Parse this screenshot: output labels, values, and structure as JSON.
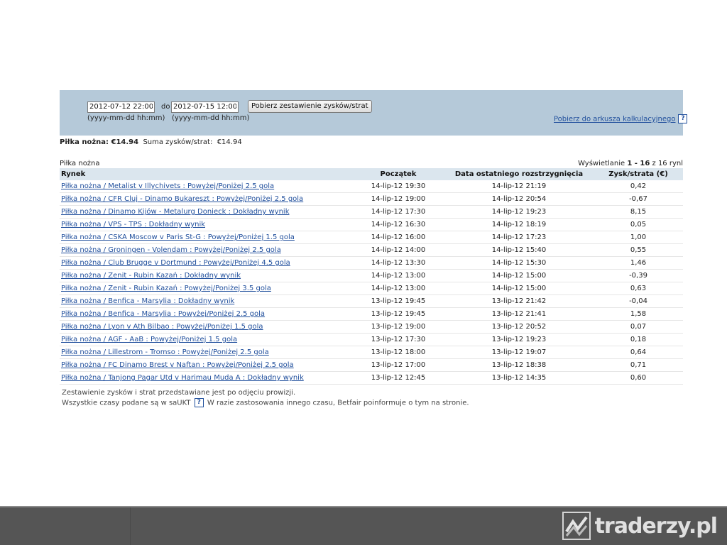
{
  "filter": {
    "date_from": "2012-07-12 22:00",
    "separator": "do",
    "date_to": "2012-07-15 12:00",
    "format_hint_from": "(yyyy-mm-dd hh:mm)",
    "format_hint_to": "(yyyy-mm-dd hh:mm)",
    "fetch_button": "Pobierz zestawienie zysków/strat",
    "download_link": "Pobierz do arkusza kalkulacyjnego",
    "help_glyph": "?"
  },
  "summary": {
    "sport_label": "Piłka nożna: €14.94",
    "total_label": "Suma zysków/strat:",
    "total_value": "€14.94"
  },
  "table": {
    "caption": "Piłka nożna",
    "showing_prefix": "Wyświetlanie",
    "showing_range": "1 - 16",
    "showing_suffix": "z 16 rynl",
    "headers": {
      "market": "Rynek",
      "start": "Początek",
      "settled": "Data ostatniego rozstrzygnięcia",
      "pl": "Zysk/strata (€)"
    },
    "rows": [
      {
        "market": "Piłka nożna / Metalist v Illychivets : Powyżej/Poniżej 2.5 gola",
        "start": "14-lip-12 19:30",
        "settled": "14-lip-12 21:19",
        "pl": "0,42"
      },
      {
        "market": "Piłka nożna / CFR Cluj - Dinamo Bukareszt : Powyżej/Poniżej 2.5 gola",
        "start": "14-lip-12 19:00",
        "settled": "14-lip-12 20:54",
        "pl": "-0,67"
      },
      {
        "market": "Piłka nożna / Dinamo Kijów - Metalurg Donieck : Dokładny wynik",
        "start": "14-lip-12 17:30",
        "settled": "14-lip-12 19:23",
        "pl": "8,15"
      },
      {
        "market": "Piłka nożna / VPS - TPS : Dokładny wynik",
        "start": "14-lip-12 16:30",
        "settled": "14-lip-12 18:19",
        "pl": "0,05"
      },
      {
        "market": "Piłka nożna / CSKA Moscow v Paris St-G : Powyżej/Poniżej 1.5 gola",
        "start": "14-lip-12 16:00",
        "settled": "14-lip-12 17:23",
        "pl": "1,00"
      },
      {
        "market": "Piłka nożna / Groningen - Volendam : Powyżej/Poniżej 2.5 gola",
        "start": "14-lip-12 14:00",
        "settled": "14-lip-12 15:40",
        "pl": "0,55"
      },
      {
        "market": "Piłka nożna / Club Brugge v Dortmund : Powyżej/Poniżej 4.5 gola",
        "start": "14-lip-12 13:30",
        "settled": "14-lip-12 15:30",
        "pl": "1,46"
      },
      {
        "market": "Piłka nożna / Zenit - Rubin Kazań : Dokładny wynik",
        "start": "14-lip-12 13:00",
        "settled": "14-lip-12 15:00",
        "pl": "-0,39"
      },
      {
        "market": "Piłka nożna / Zenit - Rubin Kazań : Powyżej/Poniżej 3.5 gola",
        "start": "14-lip-12 13:00",
        "settled": "14-lip-12 15:00",
        "pl": "0,63"
      },
      {
        "market": "Piłka nożna / Benfica - Marsylia : Dokładny wynik",
        "start": "13-lip-12 19:45",
        "settled": "13-lip-12 21:42",
        "pl": "-0,04"
      },
      {
        "market": "Piłka nożna / Benfica - Marsylia : Powyżej/Poniżej 2.5 gola",
        "start": "13-lip-12 19:45",
        "settled": "13-lip-12 21:41",
        "pl": "1,58"
      },
      {
        "market": "Piłka nożna / Lyon v Ath Bilbao : Powyżej/Poniżej 1.5 gola",
        "start": "13-lip-12 19:00",
        "settled": "13-lip-12 20:52",
        "pl": "0,07"
      },
      {
        "market": "Piłka nożna / AGF - AaB : Powyżej/Poniżej 1.5 gola",
        "start": "13-lip-12 17:30",
        "settled": "13-lip-12 19:23",
        "pl": "0,18"
      },
      {
        "market": "Piłka nożna / Lillestrom - Tromso : Powyżej/Poniżej 2.5 gola",
        "start": "13-lip-12 18:00",
        "settled": "13-lip-12 19:07",
        "pl": "0,64"
      },
      {
        "market": "Piłka nożna / FC Dinamo Brest v Naftan : Powyżej/Poniżej 2.5 gola",
        "start": "13-lip-12 17:00",
        "settled": "13-lip-12 18:38",
        "pl": "0,71"
      },
      {
        "market": "Piłka nożna / Tanjong Pagar Utd v Harimau Muda A : Dokładny wynik",
        "start": "13-lip-12 12:45",
        "settled": "13-lip-12 14:35",
        "pl": "0,60"
      }
    ]
  },
  "notes": {
    "line1": "Zestawienie zysków i strat przedstawiane jest po odjęciu prowizji.",
    "line2_prefix": "Wszystkie czasy podane są w saUKT",
    "line2_suffix": "W razie zastosowania innego czasu, Betfair poinformuje o tym na stronie."
  },
  "watermark": {
    "text": "traderzy.pl",
    "icon": "traderzy-logo-icon"
  },
  "colors": {
    "panel": "#b5c9d9",
    "header_row": "#dbe6ee",
    "link": "#1f4e9c",
    "bottom_bar": "#555555"
  }
}
